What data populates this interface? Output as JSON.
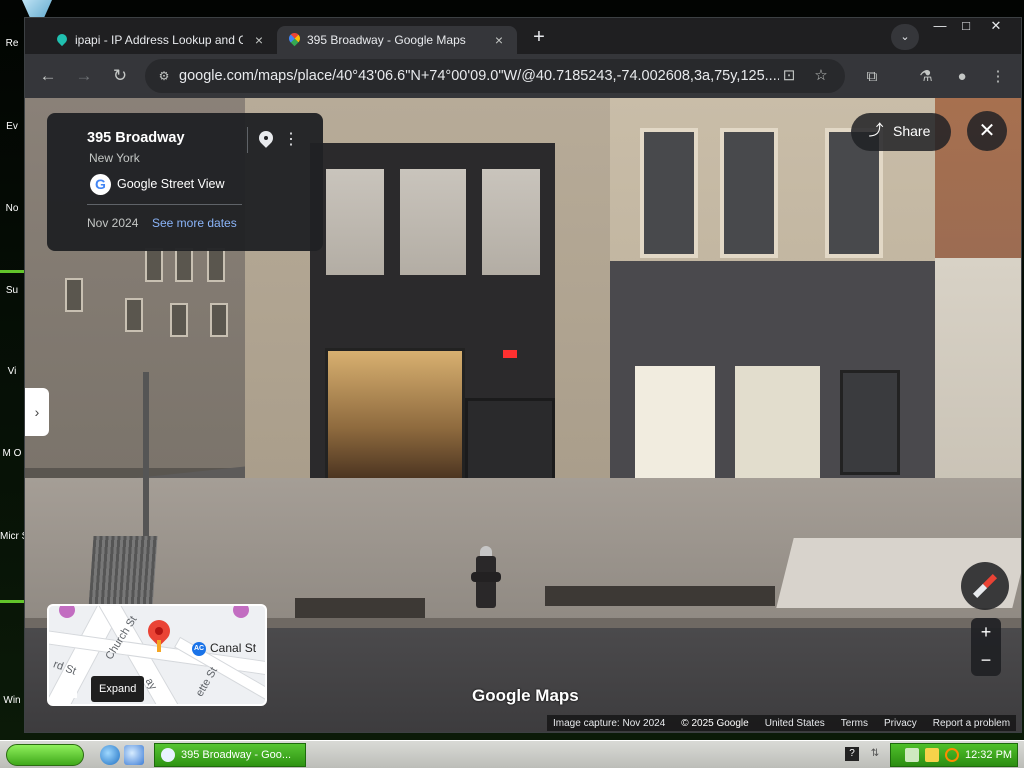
{
  "desktop": {
    "labels": [
      "Re",
      "Ev",
      "No",
      "Su",
      "Vi",
      "M O",
      "Micr Stu",
      "Win"
    ]
  },
  "browser": {
    "tabs": [
      {
        "title": "ipapi - IP Address Lookup and Geo",
        "active": false,
        "close_label": "×"
      },
      {
        "title": "395 Broadway - Google Maps",
        "active": true,
        "close_label": "×"
      }
    ],
    "new_tab_label": "+",
    "tab_search_label": "⌄",
    "window_controls": {
      "minimize": "—",
      "maximize": "□",
      "close": "✕"
    },
    "toolbar": {
      "back": "←",
      "forward": "→",
      "reload": "↻",
      "site_info": "⚙",
      "url": "google.com/maps/place/40°43'06.6\"N+74°00'09.0\"W/@40.7185243,-74.002608,3a,75y,125....",
      "install_app": "⊡",
      "bookmark": "☆",
      "extensions": "⧉",
      "labs": "⚗",
      "profile": "●",
      "menu": "⋮"
    }
  },
  "street_view": {
    "place_name": "395 Broadway",
    "city": "New York",
    "source_logo": "G",
    "source": "Google Street View",
    "capture_date": "Nov 2024",
    "more_dates_label": "See more dates",
    "more_icon": "⋮",
    "share_icon": "⤴",
    "share_label": "Share",
    "close_label": "✕",
    "expand_panel_label": "›",
    "zoom_in_label": "+",
    "zoom_out_label": "−",
    "brand": "Google Maps",
    "attribution": {
      "image_capture": "Image capture: Nov 2024",
      "copyright": "© 2025 Google",
      "region": "United States",
      "terms": "Terms",
      "privacy": "Privacy",
      "report": "Report a problem"
    },
    "minimap": {
      "streets": [
        "Church St",
        "rd St",
        "ay",
        "ette St"
      ],
      "station_badge": "AC",
      "station": "Canal St",
      "expand_icon": "⛶",
      "expand_tooltip": "Expand"
    }
  },
  "taskbar": {
    "task_button_label": "395 Broadway - Goo...",
    "help_label": "?",
    "net_label": "⇅",
    "clock": "12:32 PM"
  },
  "colors": {
    "accent_link": "#8ab4f8",
    "start_button": "#3fa81a",
    "pin_red": "#ea4335"
  }
}
